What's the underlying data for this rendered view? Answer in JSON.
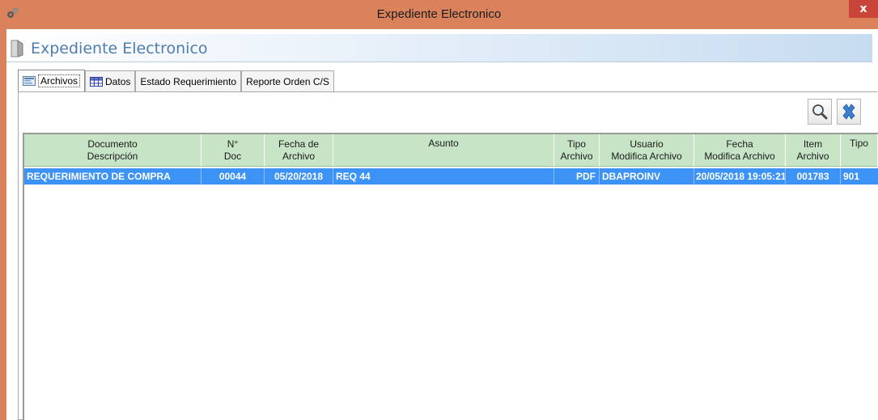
{
  "window": {
    "title": "Expediente Electronico",
    "close_label": "x"
  },
  "header": {
    "title": "Expediente Electronico"
  },
  "tabs": [
    {
      "label": "Archivos",
      "icon": "archive-icon"
    },
    {
      "label": "Datos",
      "icon": "table-icon"
    },
    {
      "label": "Estado Requerimiento"
    },
    {
      "label": "Reporte Orden C/S"
    }
  ],
  "toolbar": {
    "search_icon": "search-icon",
    "delete_icon": "delete-x-icon"
  },
  "grid": {
    "columns": [
      {
        "line1": "Documento",
        "line2": "Descripción"
      },
      {
        "line1": "N°",
        "line2": "Doc"
      },
      {
        "line1": "Fecha de",
        "line2": "Archivo"
      },
      {
        "line1": "Asunto",
        "line2": ""
      },
      {
        "line1": "Tipo",
        "line2": "Archivo"
      },
      {
        "line1": "Usuario",
        "line2": "Modifica Archivo"
      },
      {
        "line1": "Fecha",
        "line2": "Modifica Archivo"
      },
      {
        "line1": "Item",
        "line2": "Archivo"
      },
      {
        "line1": "Tipo",
        "line2": ""
      }
    ],
    "rows": [
      {
        "descripcion": "REQUERIMIENTO DE COMPRA",
        "num_doc": "00044",
        "fecha_archivo": "05/20/2018",
        "asunto": "REQ 44",
        "tipo_archivo": "PDF",
        "usuario": "DBAPROINV",
        "fecha_modifica": "20/05/2018 19:05:21",
        "item_archivo": "001783",
        "tipo": "901"
      }
    ]
  },
  "colors": {
    "titlebar": "#d9825b",
    "header_green": "#c7e4c7",
    "selected_row": "#3d93f5",
    "title_blue": "#4f7dad"
  }
}
